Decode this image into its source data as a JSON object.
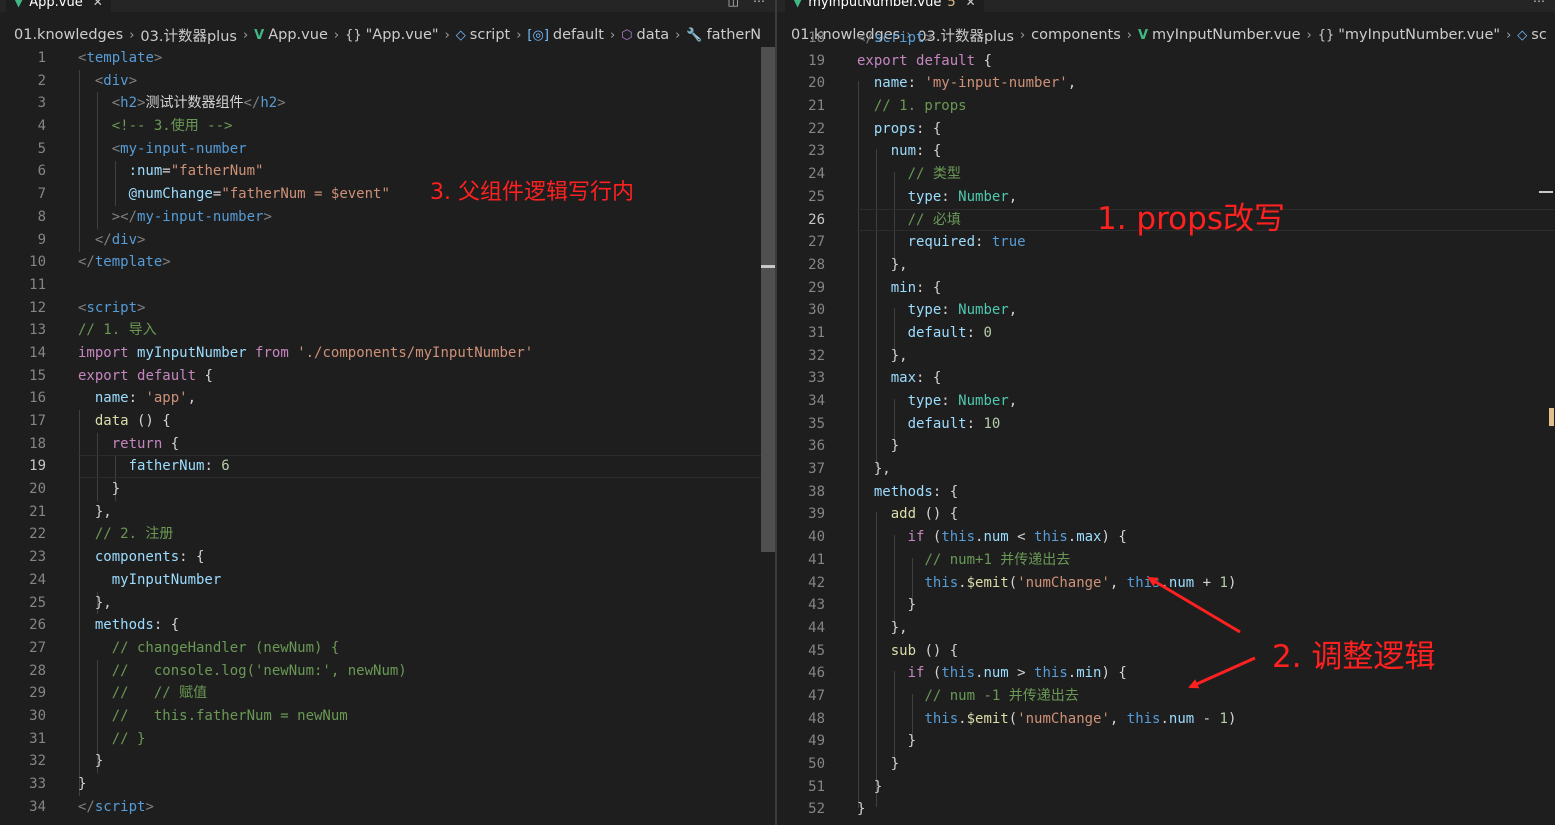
{
  "left": {
    "tab": {
      "filename": "App.vue"
    },
    "breadcrumb": [
      "01.knowledges",
      "03.计数器plus",
      "App.vue",
      "\"App.vue\"",
      "script",
      "default",
      "data",
      "fatherN"
    ],
    "active_line": 19,
    "lines": [
      {
        "n": 1,
        "t": [
          [
            "tp",
            "<"
          ],
          [
            "tk",
            "template"
          ],
          [
            "tp",
            ">"
          ]
        ]
      },
      {
        "n": 2,
        "t": [
          [
            "tw",
            "  "
          ],
          [
            "tp",
            "<"
          ],
          [
            "tk",
            "div"
          ],
          [
            "tp",
            ">"
          ]
        ]
      },
      {
        "n": 3,
        "t": [
          [
            "tw",
            "    "
          ],
          [
            "tp",
            "<"
          ],
          [
            "tk",
            "h2"
          ],
          [
            "tp",
            ">"
          ],
          [
            "tw",
            "测试计数器组件"
          ],
          [
            "tp",
            "</"
          ],
          [
            "tk",
            "h2"
          ],
          [
            "tp",
            ">"
          ]
        ]
      },
      {
        "n": 4,
        "t": [
          [
            "tw",
            "    "
          ],
          [
            "tc",
            "<!-- 3.使用 -->"
          ]
        ]
      },
      {
        "n": 5,
        "t": [
          [
            "tw",
            "    "
          ],
          [
            "tp",
            "<"
          ],
          [
            "tk",
            "my-input-number"
          ]
        ]
      },
      {
        "n": 6,
        "t": [
          [
            "tw",
            "      "
          ],
          [
            "ta",
            ":num"
          ],
          [
            "tw",
            "="
          ],
          [
            "ts",
            "\"fatherNum\""
          ]
        ]
      },
      {
        "n": 7,
        "t": [
          [
            "tw",
            "      "
          ],
          [
            "ta",
            "@numChange"
          ],
          [
            "tw",
            "="
          ],
          [
            "ts",
            "\"fatherNum = $event\""
          ]
        ]
      },
      {
        "n": 8,
        "t": [
          [
            "tw",
            "    "
          ],
          [
            "tp",
            "></"
          ],
          [
            "tk",
            "my-input-number"
          ],
          [
            "tp",
            ">"
          ]
        ]
      },
      {
        "n": 9,
        "t": [
          [
            "tw",
            "  "
          ],
          [
            "tp",
            "</"
          ],
          [
            "tk",
            "div"
          ],
          [
            "tp",
            ">"
          ]
        ]
      },
      {
        "n": 10,
        "t": [
          [
            "tp",
            "</"
          ],
          [
            "tk",
            "template"
          ],
          [
            "tp",
            ">"
          ]
        ]
      },
      {
        "n": 11,
        "t": []
      },
      {
        "n": 12,
        "t": [
          [
            "tp",
            "<"
          ],
          [
            "tk",
            "script"
          ],
          [
            "tp",
            ">"
          ]
        ]
      },
      {
        "n": 13,
        "t": [
          [
            "tc",
            "// 1. 导入"
          ]
        ]
      },
      {
        "n": 14,
        "t": [
          [
            "tkw",
            "import"
          ],
          [
            "tw",
            " "
          ],
          [
            "ta",
            "myInputNumber"
          ],
          [
            "tw",
            " "
          ],
          [
            "tkw",
            "from"
          ],
          [
            "tw",
            " "
          ],
          [
            "tstr",
            "'./components/myInputNumber'"
          ]
        ]
      },
      {
        "n": 15,
        "t": [
          [
            "tkw",
            "export"
          ],
          [
            "tw",
            " "
          ],
          [
            "tkw",
            "default"
          ],
          [
            "tw",
            " {"
          ]
        ]
      },
      {
        "n": 16,
        "t": [
          [
            "tw",
            "  "
          ],
          [
            "ta",
            "name"
          ],
          [
            "tw",
            ": "
          ],
          [
            "tstr",
            "'app'"
          ],
          [
            "tw",
            ","
          ]
        ]
      },
      {
        "n": 17,
        "t": [
          [
            "tw",
            "  "
          ],
          [
            "tf",
            "data"
          ],
          [
            "tw",
            " () {"
          ]
        ]
      },
      {
        "n": 18,
        "t": [
          [
            "tw",
            "    "
          ],
          [
            "tkw",
            "return"
          ],
          [
            "tw",
            " {"
          ]
        ]
      },
      {
        "n": 19,
        "t": [
          [
            "tw",
            "      "
          ],
          [
            "ta",
            "fatherNum"
          ],
          [
            "tw",
            ": "
          ],
          [
            "tn",
            "6"
          ]
        ]
      },
      {
        "n": 20,
        "t": [
          [
            "tw",
            "    }"
          ]
        ]
      },
      {
        "n": 21,
        "t": [
          [
            "tw",
            "  },"
          ]
        ]
      },
      {
        "n": 22,
        "t": [
          [
            "tw",
            "  "
          ],
          [
            "tc",
            "// 2. 注册"
          ]
        ]
      },
      {
        "n": 23,
        "t": [
          [
            "tw",
            "  "
          ],
          [
            "ta",
            "components"
          ],
          [
            "tw",
            ": {"
          ]
        ]
      },
      {
        "n": 24,
        "t": [
          [
            "tw",
            "    "
          ],
          [
            "ta",
            "myInputNumber"
          ]
        ]
      },
      {
        "n": 25,
        "t": [
          [
            "tw",
            "  },"
          ]
        ]
      },
      {
        "n": 26,
        "t": [
          [
            "tw",
            "  "
          ],
          [
            "ta",
            "methods"
          ],
          [
            "tw",
            ": {"
          ]
        ]
      },
      {
        "n": 27,
        "t": [
          [
            "tw",
            "    "
          ],
          [
            "tc",
            "// changeHandler (newNum) {"
          ]
        ]
      },
      {
        "n": 28,
        "t": [
          [
            "tw",
            "    "
          ],
          [
            "tc",
            "//   console.log('newNum:', newNum)"
          ]
        ]
      },
      {
        "n": 29,
        "t": [
          [
            "tw",
            "    "
          ],
          [
            "tc",
            "//   // 赋值"
          ]
        ]
      },
      {
        "n": 30,
        "t": [
          [
            "tw",
            "    "
          ],
          [
            "tc",
            "//   this.fatherNum = newNum"
          ]
        ]
      },
      {
        "n": 31,
        "t": [
          [
            "tw",
            "    "
          ],
          [
            "tc",
            "// }"
          ]
        ]
      },
      {
        "n": 32,
        "t": [
          [
            "tw",
            "  }"
          ]
        ]
      },
      {
        "n": 33,
        "t": [
          [
            "tw",
            "}"
          ]
        ]
      },
      {
        "n": 34,
        "t": [
          [
            "tp",
            "</"
          ],
          [
            "tk",
            "script"
          ],
          [
            "tp",
            ">"
          ]
        ]
      }
    ]
  },
  "right": {
    "tab": {
      "filename": "myInputNumber.vue",
      "modified_marker": "5"
    },
    "breadcrumb": [
      "01.knowledges",
      "03.计数器plus",
      "components",
      "myInputNumber.vue",
      "\"myInputNumber.vue\"",
      "sc"
    ],
    "active_line": 26,
    "lines": [
      {
        "n": 18,
        "t": [
          [
            "tp",
            "</"
          ],
          [
            "tk",
            "script"
          ],
          [
            "tp",
            ">"
          ]
        ]
      },
      {
        "n": 19,
        "t": [
          [
            "tkw",
            "export"
          ],
          [
            "tw",
            " "
          ],
          [
            "tkw",
            "default"
          ],
          [
            "tw",
            " {"
          ]
        ]
      },
      {
        "n": 20,
        "t": [
          [
            "tw",
            "  "
          ],
          [
            "ta",
            "name"
          ],
          [
            "tw",
            ": "
          ],
          [
            "tstr",
            "'my-input-number'"
          ],
          [
            "tw",
            ","
          ]
        ]
      },
      {
        "n": 21,
        "t": [
          [
            "tw",
            "  "
          ],
          [
            "tc",
            "// 1. props"
          ]
        ]
      },
      {
        "n": 22,
        "t": [
          [
            "tw",
            "  "
          ],
          [
            "ta",
            "props"
          ],
          [
            "tw",
            ": {"
          ]
        ]
      },
      {
        "n": 23,
        "t": [
          [
            "tw",
            "    "
          ],
          [
            "ta",
            "num"
          ],
          [
            "tw",
            ": {"
          ]
        ]
      },
      {
        "n": 24,
        "t": [
          [
            "tw",
            "      "
          ],
          [
            "tc",
            "// 类型"
          ]
        ]
      },
      {
        "n": 25,
        "t": [
          [
            "tw",
            "      "
          ],
          [
            "ta",
            "type"
          ],
          [
            "tw",
            ": "
          ],
          [
            "tt",
            "Number"
          ],
          [
            "tw",
            ","
          ]
        ]
      },
      {
        "n": 26,
        "t": [
          [
            "tw",
            "      "
          ],
          [
            "tc",
            "// 必填"
          ]
        ]
      },
      {
        "n": 27,
        "t": [
          [
            "tw",
            "      "
          ],
          [
            "ta",
            "required"
          ],
          [
            "tw",
            ": "
          ],
          [
            "tbool",
            "true"
          ]
        ]
      },
      {
        "n": 28,
        "t": [
          [
            "tw",
            "    },"
          ]
        ]
      },
      {
        "n": 29,
        "t": [
          [
            "tw",
            "    "
          ],
          [
            "ta",
            "min"
          ],
          [
            "tw",
            ": {"
          ]
        ]
      },
      {
        "n": 30,
        "t": [
          [
            "tw",
            "      "
          ],
          [
            "ta",
            "type"
          ],
          [
            "tw",
            ": "
          ],
          [
            "tt",
            "Number"
          ],
          [
            "tw",
            ","
          ]
        ]
      },
      {
        "n": 31,
        "t": [
          [
            "tw",
            "      "
          ],
          [
            "ta",
            "default"
          ],
          [
            "tw",
            ": "
          ],
          [
            "tn",
            "0"
          ]
        ]
      },
      {
        "n": 32,
        "t": [
          [
            "tw",
            "    },"
          ]
        ]
      },
      {
        "n": 33,
        "t": [
          [
            "tw",
            "    "
          ],
          [
            "ta",
            "max"
          ],
          [
            "tw",
            ": {"
          ]
        ]
      },
      {
        "n": 34,
        "t": [
          [
            "tw",
            "      "
          ],
          [
            "ta",
            "type"
          ],
          [
            "tw",
            ": "
          ],
          [
            "tt",
            "Number"
          ],
          [
            "tw",
            ","
          ]
        ]
      },
      {
        "n": 35,
        "t": [
          [
            "tw",
            "      "
          ],
          [
            "ta",
            "default"
          ],
          [
            "tw",
            ": "
          ],
          [
            "tn",
            "10"
          ]
        ]
      },
      {
        "n": 36,
        "t": [
          [
            "tw",
            "    }"
          ]
        ]
      },
      {
        "n": 37,
        "t": [
          [
            "tw",
            "  },"
          ]
        ]
      },
      {
        "n": 38,
        "t": [
          [
            "tw",
            "  "
          ],
          [
            "ta",
            "methods"
          ],
          [
            "tw",
            ": {"
          ]
        ]
      },
      {
        "n": 39,
        "t": [
          [
            "tw",
            "    "
          ],
          [
            "tf",
            "add"
          ],
          [
            "tw",
            " () {"
          ]
        ]
      },
      {
        "n": 40,
        "t": [
          [
            "tw",
            "      "
          ],
          [
            "tkw",
            "if"
          ],
          [
            "tw",
            " ("
          ],
          [
            "tthis",
            "this"
          ],
          [
            "tw",
            "."
          ],
          [
            "ta",
            "num"
          ],
          [
            "tw",
            " < "
          ],
          [
            "tthis",
            "this"
          ],
          [
            "tw",
            "."
          ],
          [
            "ta",
            "max"
          ],
          [
            "tw",
            ") {"
          ]
        ]
      },
      {
        "n": 41,
        "t": [
          [
            "tw",
            "        "
          ],
          [
            "tc",
            "// num+1 并传递出去"
          ]
        ]
      },
      {
        "n": 42,
        "t": [
          [
            "tw",
            "        "
          ],
          [
            "tthis",
            "this"
          ],
          [
            "tw",
            "."
          ],
          [
            "tf",
            "$emit"
          ],
          [
            "tw",
            "("
          ],
          [
            "tstr",
            "'numChange'"
          ],
          [
            "tw",
            ", "
          ],
          [
            "tthis",
            "this"
          ],
          [
            "tw",
            "."
          ],
          [
            "ta",
            "num"
          ],
          [
            "tw",
            " + "
          ],
          [
            "tn",
            "1"
          ],
          [
            "tw",
            ")"
          ]
        ]
      },
      {
        "n": 43,
        "t": [
          [
            "tw",
            "      }"
          ]
        ]
      },
      {
        "n": 44,
        "t": [
          [
            "tw",
            "    },"
          ]
        ]
      },
      {
        "n": 45,
        "t": [
          [
            "tw",
            "    "
          ],
          [
            "tf",
            "sub"
          ],
          [
            "tw",
            " () {"
          ]
        ]
      },
      {
        "n": 46,
        "t": [
          [
            "tw",
            "      "
          ],
          [
            "tkw",
            "if"
          ],
          [
            "tw",
            " ("
          ],
          [
            "tthis",
            "this"
          ],
          [
            "tw",
            "."
          ],
          [
            "ta",
            "num"
          ],
          [
            "tw",
            " > "
          ],
          [
            "tthis",
            "this"
          ],
          [
            "tw",
            "."
          ],
          [
            "ta",
            "min"
          ],
          [
            "tw",
            ") {"
          ]
        ]
      },
      {
        "n": 47,
        "t": [
          [
            "tw",
            "        "
          ],
          [
            "tc",
            "// num -1 并传递出去"
          ]
        ]
      },
      {
        "n": 48,
        "t": [
          [
            "tw",
            "        "
          ],
          [
            "tthis",
            "this"
          ],
          [
            "tw",
            "."
          ],
          [
            "tf",
            "$emit"
          ],
          [
            "tw",
            "("
          ],
          [
            "tstr",
            "'numChange'"
          ],
          [
            "tw",
            ", "
          ],
          [
            "tthis",
            "this"
          ],
          [
            "tw",
            "."
          ],
          [
            "ta",
            "num"
          ],
          [
            "tw",
            " - "
          ],
          [
            "tn",
            "1"
          ],
          [
            "tw",
            ")"
          ]
        ]
      },
      {
        "n": 49,
        "t": [
          [
            "tw",
            "      }"
          ]
        ]
      },
      {
        "n": 50,
        "t": [
          [
            "tw",
            "    }"
          ]
        ]
      },
      {
        "n": 51,
        "t": [
          [
            "tw",
            "  }"
          ]
        ]
      },
      {
        "n": 52,
        "t": [
          [
            "tw",
            "}"
          ]
        ]
      }
    ]
  },
  "annotations": {
    "parent_inline": "3. 父组件逻辑写行内",
    "props_rewrite": "1. props改写",
    "adjust_logic": "2. 调整逻辑"
  },
  "colors": {
    "annotation": "#ff2020",
    "editor_bg": "#1e1e1e",
    "vue_green": "#41b883"
  }
}
